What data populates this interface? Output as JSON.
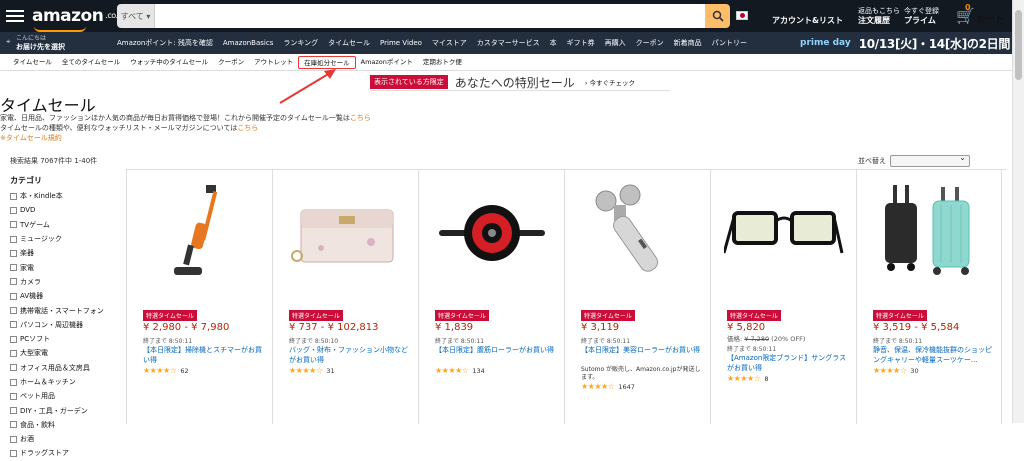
{
  "header": {
    "logo": "amazon",
    "logo_suffix": ".co.jp",
    "search_category": "すべて",
    "search_placeholder": "",
    "account_line1": "アカウント&リスト",
    "orders_line1": "返品もこちら",
    "orders_line2": "注文履歴",
    "prime_line1": "今すぐ登録",
    "prime_line2": "プライム",
    "cart_count": "0",
    "cart_label": "カート"
  },
  "nav2": {
    "location_line1": "こんにちは",
    "location_line2": "お届け先を選択",
    "items": [
      "Amazonポイント: 残高を確認",
      "AmazonBasics",
      "ランキング",
      "タイムセール",
      "Prime Video",
      "マイストア",
      "カスタマーサービス",
      "本",
      "ギフト券",
      "再購入",
      "クーポン",
      "新着商品",
      "パントリー"
    ],
    "prime_day_label": "prime day",
    "prime_day_dates": "10/13[火]・14[水]の2日間"
  },
  "subnav": {
    "items": [
      "タイムセール",
      "全てのタイムセール",
      "ウォッチ中のタイムセール",
      "クーポン",
      "アウトレット",
      "在庫処分セール",
      "Amazonポイント",
      "定期おトク便"
    ],
    "highlighted_index": 5,
    "highlight_color": "#e53935"
  },
  "banner": {
    "tag": "表示されている方限定",
    "title": "あなたへの特別セール",
    "link": "今すぐチェック"
  },
  "page": {
    "title": "タイムセール",
    "desc1_a": "家電、日用品、ファッションほか人気の商品が毎日お買得価格で登場！これから開催予定のタイムセール一覧は",
    "desc_link": "こちら",
    "desc2_a": "タイムセールの種類や、便利なウォッチリスト・メールマガジンについては",
    "desc2_link": "こちら",
    "desc3": "※タイムセール規約",
    "result_count": "検索結果 7067件中 1-40件",
    "sort_label": "並べ替え"
  },
  "sidebar": {
    "heading": "カテゴリ",
    "items": [
      "本・Kindle本",
      "DVD",
      "TVゲーム",
      "ミュージック",
      "楽器",
      "家電",
      "カメラ",
      "AV機器",
      "携帯電話・スマートフォン",
      "パソコン・周辺機器",
      "PCソフト",
      "大型家電",
      "オフィス用品＆文房具",
      "ホーム＆キッチン",
      "ペット用品",
      "DIY・工具・ガーデン",
      "食品・飲料",
      "お酒",
      "ドラッグストア"
    ]
  },
  "products": [
    {
      "icon": "vacuum-cleaner-icon",
      "badge": "特選タイムセール",
      "price": "¥ 2,980 - ¥ 7,980",
      "strike": "",
      "ends": "終了まで 8:50:11",
      "title": "【本日限定】掃除機とスチマーがお買い得",
      "seller": "",
      "stars_value": 4.5,
      "stars_text": "★★★★☆",
      "reviews": "62"
    },
    {
      "icon": "wallet-icon",
      "badge": "特選タイムセール",
      "price": "¥ 737 - ¥ 102,813",
      "strike": "",
      "ends": "終了まで 8:50:10",
      "title": "バッグ・財布・ファッション小物などがお買い得",
      "seller": "",
      "stars_value": 4.0,
      "stars_text": "★★★★☆",
      "reviews": "31"
    },
    {
      "icon": "ab-roller-icon",
      "badge": "特選タイムセール",
      "price": "¥ 1,839",
      "strike": "",
      "ends": "終了まで 8:50:11",
      "title": "【本日限定】腹筋ローラーがお買い得",
      "seller": "",
      "stars_value": 4.5,
      "stars_text": "★★★★☆",
      "reviews": "134"
    },
    {
      "icon": "facial-roller-icon",
      "badge": "特選タイムセール",
      "price": "¥ 3,119",
      "strike": "",
      "ends": "終了まで 8:50:11",
      "title": "【本日限定】美容ローラーがお買い得",
      "seller": "Sutomo が販売し、Amazon.co.jpが発送します。",
      "stars_value": 4.0,
      "stars_text": "★★★★☆",
      "reviews": "1647"
    },
    {
      "icon": "glasses-icon",
      "badge": "特選タイムセール",
      "price": "¥ 5,820",
      "strike_label": "価格:",
      "strike": "¥ 7,280",
      "strike_pct": "(20% OFF)",
      "ends": "終了まで 8:50:11",
      "title": "【Amazon限定ブランド】サングラスがお買い得",
      "seller": "",
      "stars_value": 4.0,
      "stars_text": "★★★★☆",
      "reviews": "8"
    },
    {
      "icon": "suitcase-icon",
      "badge": "特選タイムセール",
      "price": "¥ 3,519 - ¥ 5,584",
      "strike": "",
      "ends": "終了まで 8:50:11",
      "title": "静音、保温、保冷機能抜群のショッピングキャリーや軽量スーツケー...",
      "seller": "",
      "stars_value": 4.5,
      "stars_text": "★★★★☆",
      "reviews": "30"
    }
  ],
  "colors": {
    "header": "#131921",
    "nav2": "#232f3e",
    "search_button": "#febd69",
    "price": "#b12704",
    "badge": "#cc0c39",
    "link": "#0066c0",
    "star": "#ffa41c"
  }
}
